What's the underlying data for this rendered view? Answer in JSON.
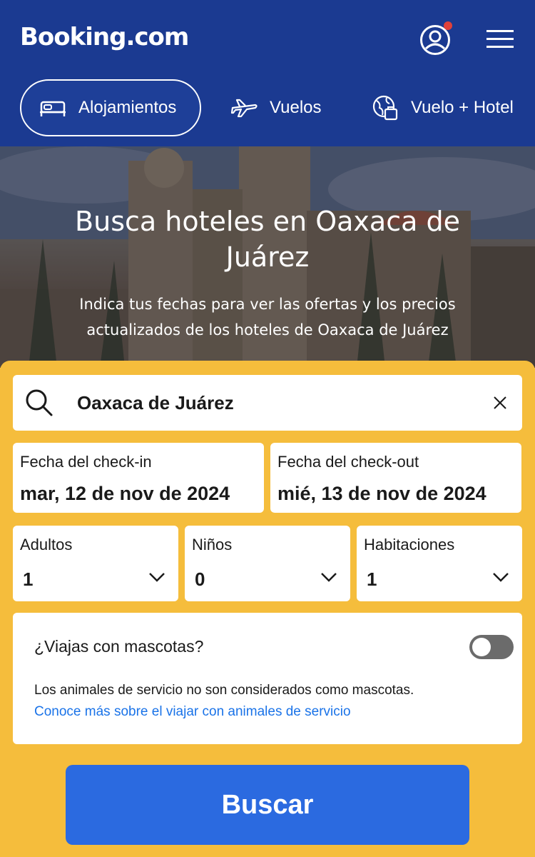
{
  "header": {
    "logo": "Booking.com",
    "tabs": [
      {
        "label": "Alojamientos",
        "icon": "bed-icon",
        "active": true
      },
      {
        "label": "Vuelos",
        "icon": "airplane-icon",
        "active": false
      },
      {
        "label": "Vuelo + Hotel",
        "icon": "globe-luggage-icon",
        "active": false
      }
    ]
  },
  "hero": {
    "title": "Busca hoteles en Oaxaca de Juárez",
    "subtitle": "Indica tus fechas para ver las ofertas y los precios actualizados de los hoteles de Oaxaca de Juárez"
  },
  "search": {
    "destination": "Oaxaca de Juárez",
    "checkin": {
      "label": "Fecha del check-in",
      "value": "mar, 12 de nov de 2024"
    },
    "checkout": {
      "label": "Fecha del check-out",
      "value": "mié, 13 de nov de 2024"
    },
    "adults": {
      "label": "Adultos",
      "value": "1"
    },
    "children": {
      "label": "Niños",
      "value": "0"
    },
    "rooms": {
      "label": "Habitaciones",
      "value": "1"
    },
    "pets": {
      "question": "¿Viajas con mascotas?",
      "enabled": false,
      "note": "Los animales de servicio no son considerados como mascotas.",
      "link": "Conoce más sobre el viajar con animales de servicio"
    },
    "submit": "Buscar"
  },
  "colors": {
    "brand_blue": "#1b3a91",
    "panel_yellow": "#f5bd3c",
    "button_blue": "#2b6ae0",
    "link_blue": "#1a73e8",
    "notification_red": "#e0413a"
  }
}
